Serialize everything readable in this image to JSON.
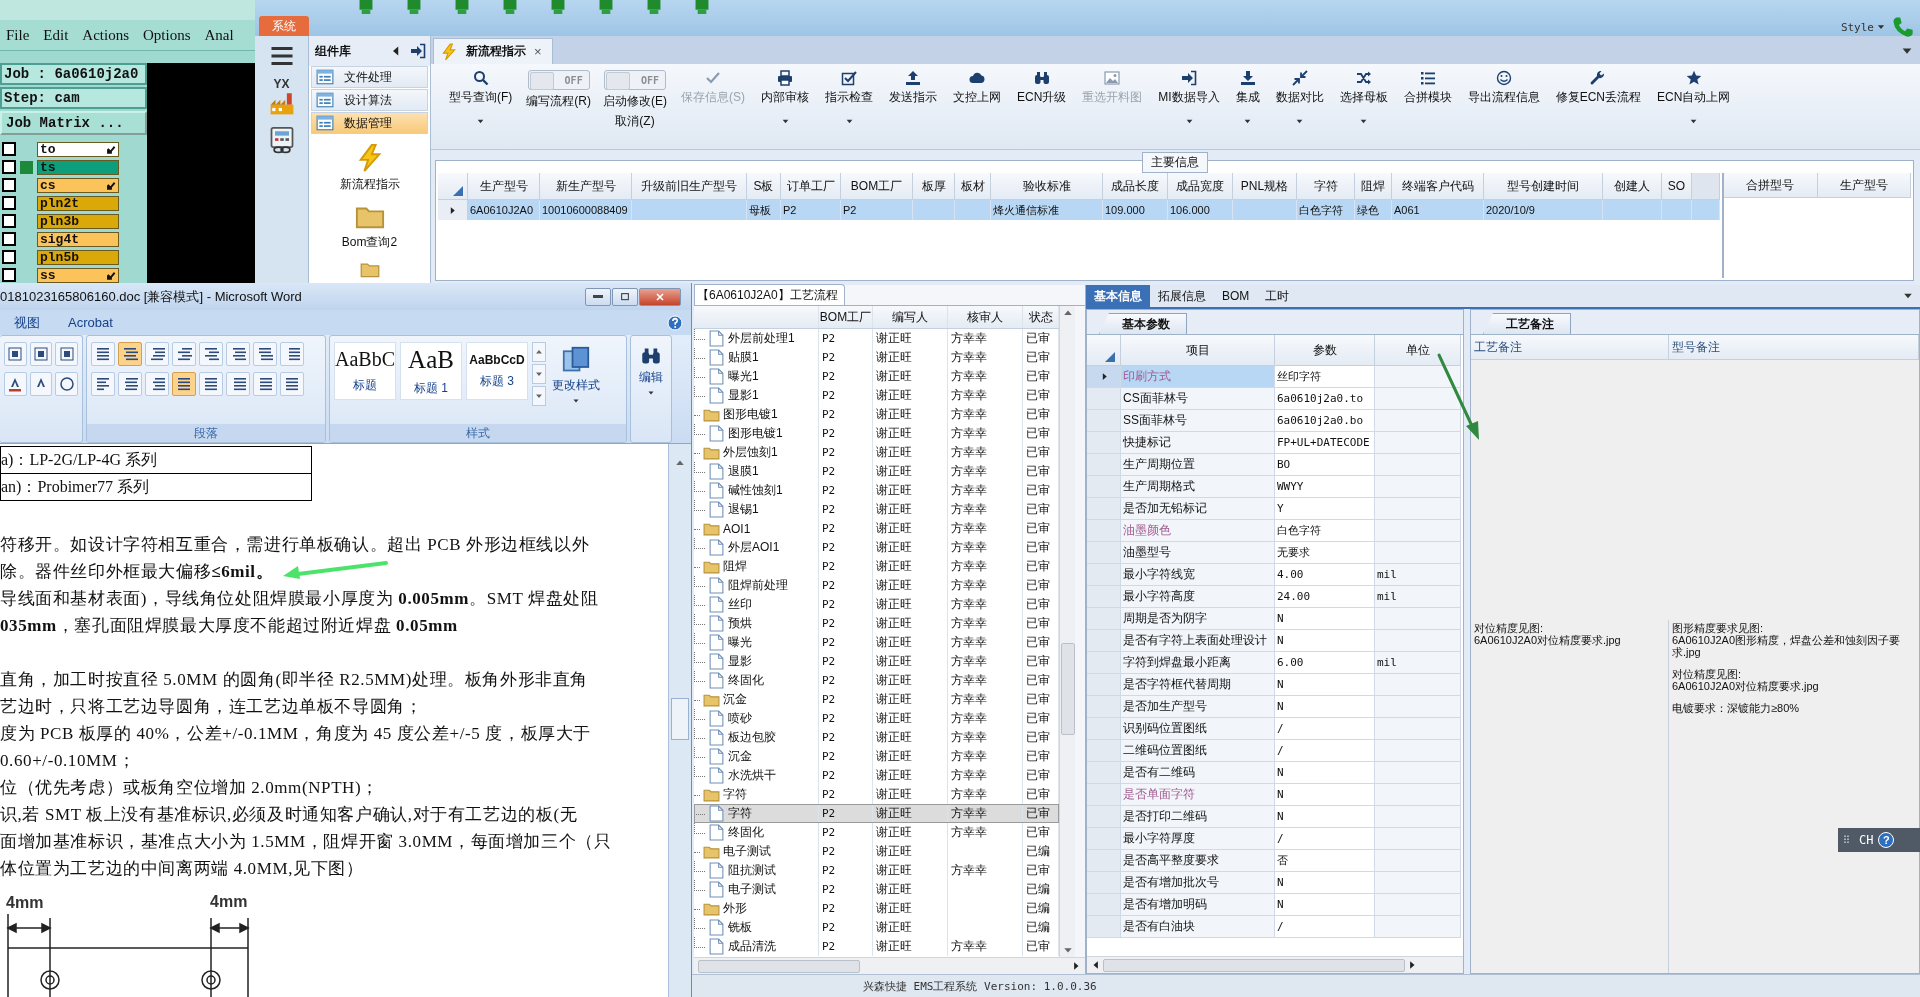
{
  "cam_window": {
    "menu": [
      "File",
      "Edit",
      "Actions",
      "Options",
      "Anal"
    ],
    "job": "Job : 6a0610j2a0",
    "step": "Step: cam",
    "matrix_button": "Job Matrix ...",
    "layers": [
      {
        "name": "to",
        "color": "#ffffff",
        "checked": false,
        "selected": false,
        "marked": true
      },
      {
        "name": "ts",
        "color": "#0e9e7c",
        "checked": false,
        "selected": true,
        "marked": false
      },
      {
        "name": "cs",
        "color": "#fbc35a",
        "checked": false,
        "selected": false,
        "marked": true
      },
      {
        "name": "pln2t",
        "color": "#dba80a",
        "checked": false,
        "selected": false,
        "marked": false
      },
      {
        "name": "pln3b",
        "color": "#dba80a",
        "checked": false,
        "selected": false,
        "marked": false
      },
      {
        "name": "sig4t",
        "color": "#fbc35a",
        "checked": false,
        "selected": false,
        "marked": false
      },
      {
        "name": "pln5b",
        "color": "#dba80a",
        "checked": false,
        "selected": false,
        "marked": false
      },
      {
        "name": "ss",
        "color": "#fbc35a",
        "checked": false,
        "selected": false,
        "marked": true
      }
    ]
  },
  "ems": {
    "system_tab": "系统",
    "style_menu": "Style",
    "logo_text": "YX",
    "component_library": {
      "title": "组件库",
      "items": [
        {
          "label": "文件处理",
          "selected": false
        },
        {
          "label": "设计算法",
          "selected": false
        },
        {
          "label": "数据管理",
          "selected": true
        }
      ],
      "tools": [
        {
          "label": "新流程指示",
          "kind": "lightning"
        },
        {
          "label": "Bom查询2",
          "kind": "folder"
        },
        {
          "kind": "folder"
        }
      ]
    },
    "tab": {
      "label": "新流程指示",
      "close": "×"
    },
    "toolbar": [
      {
        "kind": "button",
        "label": "型号查询(F)",
        "disabled": false,
        "dropdown": true
      },
      {
        "kind": "toggle",
        "label": "编写流程(R)",
        "toggle_text": "OFF",
        "on": false
      },
      {
        "kind": "toggle",
        "label": "启动修改(E)",
        "sublabel": "取消(Z)",
        "toggle_text": "OFF",
        "on": false
      },
      {
        "kind": "button",
        "label": "保存信息(S)",
        "disabled": true,
        "dropdown": false
      },
      {
        "kind": "button",
        "label": "内部审核",
        "disabled": false,
        "dropdown": true
      },
      {
        "kind": "button",
        "label": "指示检查",
        "disabled": false,
        "dropdown": true
      },
      {
        "kind": "button",
        "label": "发送指示",
        "disabled": false,
        "dropdown": false
      },
      {
        "kind": "button",
        "label": "文控上网",
        "disabled": false,
        "dropdown": false
      },
      {
        "kind": "button",
        "label": "ECN升级",
        "disabled": false,
        "dropdown": false
      },
      {
        "kind": "button",
        "label": "重选开料图",
        "disabled": true,
        "dropdown": false
      },
      {
        "kind": "button",
        "label": "MI数据导入",
        "disabled": false,
        "dropdown": true
      },
      {
        "kind": "button",
        "label": "集成",
        "disabled": false,
        "dropdown": true
      },
      {
        "kind": "button",
        "label": "数据对比",
        "disabled": false,
        "dropdown": true
      },
      {
        "kind": "button",
        "label": "选择母板",
        "disabled": false,
        "dropdown": true
      },
      {
        "kind": "button",
        "label": "合拼模块",
        "disabled": false,
        "dropdown": false
      },
      {
        "kind": "button",
        "label": "导出流程信息",
        "disabled": false,
        "dropdown": false
      },
      {
        "kind": "button",
        "label": "修复ECN丢流程",
        "disabled": false,
        "dropdown": false
      },
      {
        "kind": "button",
        "label": "ECN自动上网",
        "disabled": false,
        "dropdown": true
      }
    ],
    "main_info": {
      "title": "主要信息",
      "columns": [
        "生产型号",
        "新生产型号",
        "升级前旧生产型号",
        "S板",
        "订单工厂",
        "BOM工厂",
        "板厚",
        "板材",
        "验收标准",
        "成品长度",
        "成品宽度",
        "PNL规格",
        "字符",
        "阻焊",
        "终端客户代码",
        "型号创建时间",
        "创建人",
        "SO"
      ],
      "rows": [
        {
          "selected": true,
          "cells": [
            "6A0610J2A0",
            "10010600088409",
            null,
            "母板",
            "P2",
            "P2",
            null,
            null,
            "烽火通信标准",
            "109.000",
            "106.000",
            null,
            "白色字符",
            "绿色",
            "A061",
            "2020/10/9",
            null,
            null
          ]
        }
      ],
      "merge_columns": [
        "合拼型号",
        "生产型号"
      ]
    },
    "process_flow": {
      "title": "【6A0610J2A0】工艺流程",
      "columns": [
        "BOM工厂",
        "编写人",
        "核审人",
        "状态"
      ],
      "groups": [
        {
          "children": [
            {
              "name": "外层前处理1",
              "factory": "P2",
              "author": "谢正旺",
              "reviewer": "方幸幸",
              "status": "已审",
              "selected": false
            },
            {
              "name": "贴膜1",
              "factory": "P2",
              "author": "谢正旺",
              "reviewer": "方幸幸",
              "status": "已审",
              "selected": false
            },
            {
              "name": "曝光1",
              "factory": "P2",
              "author": "谢正旺",
              "reviewer": "方幸幸",
              "status": "已审",
              "selected": false
            },
            {
              "name": "显影1",
              "factory": "P2",
              "author": "谢正旺",
              "reviewer": "方幸幸",
              "status": "已审",
              "selected": false
            }
          ]
        },
        {
          "name": "图形电镀1",
          "factory": "P2",
          "author": "谢正旺",
          "reviewer": "方幸幸",
          "status": "已审",
          "selected": false,
          "children": [
            {
              "name": "图形电镀1",
              "factory": "P2",
              "author": "谢正旺",
              "reviewer": "方幸幸",
              "status": "已审",
              "selected": false
            }
          ]
        },
        {
          "name": "外层蚀刻1",
          "factory": "P2",
          "author": "谢正旺",
          "reviewer": "方幸幸",
          "status": "已审",
          "selected": false,
          "children": [
            {
              "name": "退膜1",
              "factory": "P2",
              "author": "谢正旺",
              "reviewer": "方幸幸",
              "status": "已审",
              "selected": false
            },
            {
              "name": "碱性蚀刻1",
              "factory": "P2",
              "author": "谢正旺",
              "reviewer": "方幸幸",
              "status": "已审",
              "selected": false
            },
            {
              "name": "退锡1",
              "factory": "P2",
              "author": "谢正旺",
              "reviewer": "方幸幸",
              "status": "已审",
              "selected": false
            }
          ]
        },
        {
          "name": "AOI1",
          "factory": "P2",
          "author": "谢正旺",
          "reviewer": "方幸幸",
          "status": "已审",
          "selected": false,
          "children": [
            {
              "name": "外层AOI1",
              "factory": "P2",
              "author": "谢正旺",
              "reviewer": "方幸幸",
              "status": "已审",
              "selected": false
            }
          ]
        },
        {
          "name": "阻焊",
          "factory": "P2",
          "author": "谢正旺",
          "reviewer": "方幸幸",
          "status": "已审",
          "selected": false,
          "children": [
            {
              "name": "阻焊前处理",
              "factory": "P2",
              "author": "谢正旺",
              "reviewer": "方幸幸",
              "status": "已审",
              "selected": false
            },
            {
              "name": "丝印",
              "factory": "P2",
              "author": "谢正旺",
              "reviewer": "方幸幸",
              "status": "已审",
              "selected": false
            },
            {
              "name": "预烘",
              "factory": "P2",
              "author": "谢正旺",
              "reviewer": "方幸幸",
              "status": "已审",
              "selected": false
            },
            {
              "name": "曝光",
              "factory": "P2",
              "author": "谢正旺",
              "reviewer": "方幸幸",
              "status": "已审",
              "selected": false
            },
            {
              "name": "显影",
              "factory": "P2",
              "author": "谢正旺",
              "reviewer": "方幸幸",
              "status": "已审",
              "selected": false
            },
            {
              "name": "终固化",
              "factory": "P2",
              "author": "谢正旺",
              "reviewer": "方幸幸",
              "status": "已审",
              "selected": false
            }
          ]
        },
        {
          "name": "沉金",
          "factory": "P2",
          "author": "谢正旺",
          "reviewer": "方幸幸",
          "status": "已审",
          "selected": false,
          "children": [
            {
              "name": "喷砂",
              "factory": "P2",
              "author": "谢正旺",
              "reviewer": "方幸幸",
              "status": "已审",
              "selected": false
            },
            {
              "name": "板边包胶",
              "factory": "P2",
              "author": "谢正旺",
              "reviewer": "方幸幸",
              "status": "已审",
              "selected": false
            },
            {
              "name": "沉金",
              "factory": "P2",
              "author": "谢正旺",
              "reviewer": "方幸幸",
              "status": "已审",
              "selected": false
            },
            {
              "name": "水洗烘干",
              "factory": "P2",
              "author": "谢正旺",
              "reviewer": "方幸幸",
              "status": "已审",
              "selected": false
            }
          ]
        },
        {
          "name": "字符",
          "factory": "P2",
          "author": "谢正旺",
          "reviewer": "方幸幸",
          "status": "已审",
          "selected": false,
          "children": [
            {
              "name": "字符",
              "factory": "P2",
              "author": "谢正旺",
              "reviewer": "方幸幸",
              "status": "已审",
              "selected": true
            },
            {
              "name": "终固化",
              "factory": "P2",
              "author": "谢正旺",
              "reviewer": "方幸幸",
              "status": "已审",
              "selected": false
            }
          ]
        },
        {
          "name": "电子测试",
          "factory": "P2",
          "author": "谢正旺",
          "status": "已编",
          "selected": false,
          "children": [
            {
              "name": "阻抗测试",
              "factory": "P2",
              "author": "谢正旺",
              "reviewer": "方幸幸",
              "status": "已审",
              "selected": false
            },
            {
              "name": "电子测试",
              "factory": "P2",
              "author": "谢正旺",
              "status": "已编",
              "selected": false
            }
          ]
        },
        {
          "name": "外形",
          "factory": "P2",
          "author": "谢正旺",
          "status": "已编",
          "selected": false,
          "children": [
            {
              "name": "铣板",
              "factory": "P2",
              "author": "谢正旺",
              "status": "已编",
              "selected": false
            },
            {
              "name": "成品清洗",
              "factory": "P2",
              "author": "谢正旺",
              "reviewer": "方幸幸",
              "status": "已审",
              "selected": false
            }
          ]
        }
      ]
    },
    "detail_tabs": [
      {
        "label": "基本信息",
        "selected": true
      },
      {
        "label": "拓展信息",
        "selected": false
      },
      {
        "label": "BOM",
        "selected": false
      },
      {
        "label": "工时",
        "selected": false
      }
    ],
    "basic_params": {
      "tab": "基本参数",
      "columns": [
        "项目",
        "参数",
        "单位"
      ],
      "rows": [
        {
          "name": "印刷方式",
          "value": "丝印字符",
          "selected": true,
          "emphasis": true
        },
        {
          "name": "CS面菲林号",
          "value": "6a0610j2a0.to",
          "selected": false,
          "emphasis": false
        },
        {
          "name": "SS面菲林号",
          "value": "6a0610j2a0.bo",
          "selected": false,
          "emphasis": false
        },
        {
          "name": "快捷标记",
          "value": "FP+UL+DATECODE",
          "selected": false,
          "emphasis": false
        },
        {
          "name": "生产周期位置",
          "value": "BO",
          "selected": false,
          "emphasis": false
        },
        {
          "name": "生产周期格式",
          "value": "WWYY",
          "selected": false,
          "emphasis": false
        },
        {
          "name": "是否加无铅标记",
          "value": "Y",
          "selected": false,
          "emphasis": false
        },
        {
          "name": "油墨颜色",
          "value": "白色字符",
          "selected": false,
          "emphasis": true
        },
        {
          "name": "油墨型号",
          "value": "无要求",
          "selected": false,
          "emphasis": false
        },
        {
          "name": "最小字符线宽",
          "value": "4.00",
          "unit": "mil",
          "selected": false,
          "emphasis": false
        },
        {
          "name": "最小字符高度",
          "value": "24.00",
          "unit": "mil",
          "selected": false,
          "emphasis": false
        },
        {
          "name": "周期是否为阴字",
          "value": "N",
          "selected": false,
          "emphasis": false
        },
        {
          "name": "是否有字符上表面处理设计",
          "value": "N",
          "selected": false,
          "emphasis": false
        },
        {
          "name": "字符到焊盘最小距离",
          "value": "6.00",
          "unit": "mil",
          "selected": false,
          "emphasis": false
        },
        {
          "name": "是否字符框代替周期",
          "value": "N",
          "selected": false,
          "emphasis": false
        },
        {
          "name": "是否加生产型号",
          "value": "N",
          "selected": false,
          "emphasis": false
        },
        {
          "name": "识别码位置图纸",
          "value": "/",
          "selected": false,
          "emphasis": false
        },
        {
          "name": "二维码位置图纸",
          "value": "/",
          "selected": false,
          "emphasis": false
        },
        {
          "name": "是否有二维码",
          "value": "N",
          "selected": false,
          "emphasis": false
        },
        {
          "name": "是否单面字符",
          "value": "N",
          "selected": false,
          "emphasis": true
        },
        {
          "name": "是否打印二维码",
          "value": "N",
          "selected": false,
          "emphasis": false
        },
        {
          "name": "最小字符厚度",
          "value": "/",
          "selected": false,
          "emphasis": false
        },
        {
          "name": "是否高平整度要求",
          "value": "否",
          "selected": false,
          "emphasis": false
        },
        {
          "name": "是否有增加批次号",
          "value": "N",
          "selected": false,
          "emphasis": false
        },
        {
          "name": "是否有增加明码",
          "value": "N",
          "selected": false,
          "emphasis": false
        },
        {
          "name": "是否有白油块",
          "value": "/",
          "selected": false,
          "emphasis": false
        }
      ]
    },
    "notes": {
      "tab": "工艺备注",
      "columns": [
        "工艺备注",
        "型号备注"
      ],
      "process_notes": [
        [
          "对位精度见图:",
          "6A0610J2A0对位精度要求.jpg"
        ]
      ],
      "model_notes": [
        [
          "图形精度要求见图:",
          "6A0610J2A0图形精度，焊盘公差和蚀刻因子要求.jpg"
        ],
        [
          "对位精度见图:",
          "6A0610J2A0对位精度要求.jpg"
        ],
        [
          "电镀要求：深镀能力≥80%"
        ]
      ]
    },
    "status_bar": "兴森快捷 EMS工程系统 Version: 1.0.0.36"
  },
  "word_window": {
    "title": "0181023165806160.doc [兼容模式] - Microsoft Word",
    "tabs": [
      "视图",
      "Acrobat"
    ],
    "paragraph_tools": [
      {
        "selected": false
      },
      {
        "selected": true
      },
      {
        "selected": false
      },
      {
        "selected": false
      },
      {
        "selected": false
      },
      {
        "selected": false
      },
      {
        "selected": false
      },
      {
        "selected": false
      },
      {
        "selected": false
      },
      {
        "selected": false
      },
      {
        "selected": false
      },
      {
        "selected": true
      },
      {
        "selected": false
      },
      {
        "selected": false
      },
      {
        "selected": false
      },
      {
        "selected": false
      }
    ],
    "styles": [
      {
        "sample": "AaBbC",
        "label": "标题"
      },
      {
        "sample": "AaB",
        "label": "标题 1"
      },
      {
        "sample": "AaBbCcD",
        "label": "标题 3"
      }
    ],
    "change_styles": "更改样式",
    "edit": "编辑",
    "groups": [
      "段落",
      "样式"
    ],
    "table_rows": [
      "a)：LP-2G/LP-4G 系列",
      "an)：Probimer77 系列"
    ],
    "blocks": [
      [
        "符移开。如设计字符相互重合，需进行单板确认。超出 PCB 外形边框线以外",
        "除。器件丝印外框最大偏移**≤6mil。**",
        "导线面和基材表面)，导线角位处阻焊膜最小厚度为 **0.005mm**。SMT 焊盘处阻",
        "**035mm**，塞孔面阻焊膜最大厚度不能超过附近焊盘 **0.05mm**"
      ],
      [
        "直角，加工时按直径 5.0MM 的圆角(即半径 R2.5MM)处理。板角外形非直角",
        "艺边时，只将工艺边导圆角，连工艺边单板不导圆角；",
        "度为 PCB 板厚的 40%，公差+/-0.1MM，角度为 45 度公差+/-5 度，板厚大于",
        "0.60+/-0.10MM；",
        "位（优先考虑）或板角空位增加 2.0mm(NPTH)；",
        "识,若 SMT 板上没有基准标识,必须及时通知客户确认,对于有工艺边的板(无",
        "面增加基准标识，基准点大小为 1.5MM，阻焊开窗 3.0MM，每面增加三个（只",
        "体位置为工艺边的中间离两端 4.0MM,见下图）"
      ]
    ],
    "diagram_labels": [
      "4mm",
      "4mm"
    ]
  },
  "ime_bar": {
    "label": "CH",
    "help": "?"
  }
}
